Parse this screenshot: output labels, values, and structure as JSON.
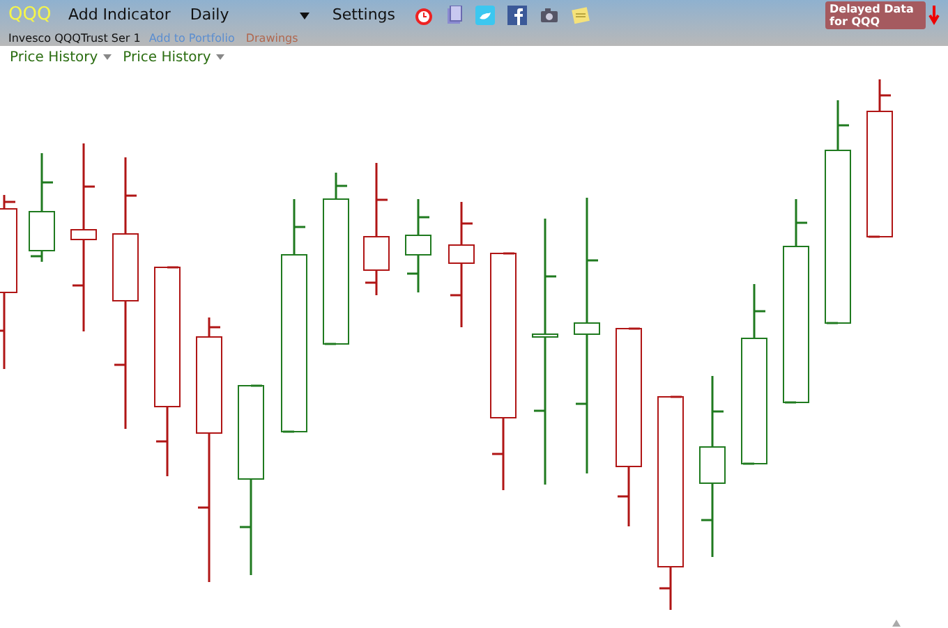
{
  "toolbar": {
    "symbol": "QQQ",
    "add_indicator": "Add Indicator",
    "interval": "Daily",
    "settings": "Settings",
    "delayed_badge": "Delayed Data for QQQ"
  },
  "info_bar": {
    "security_name": "Invesco QQQTrust Ser 1",
    "add_to_portfolio": "Add to Portfolio",
    "drawings": "Drawings"
  },
  "chart_menus": [
    "Price History",
    "Price History"
  ]
}
